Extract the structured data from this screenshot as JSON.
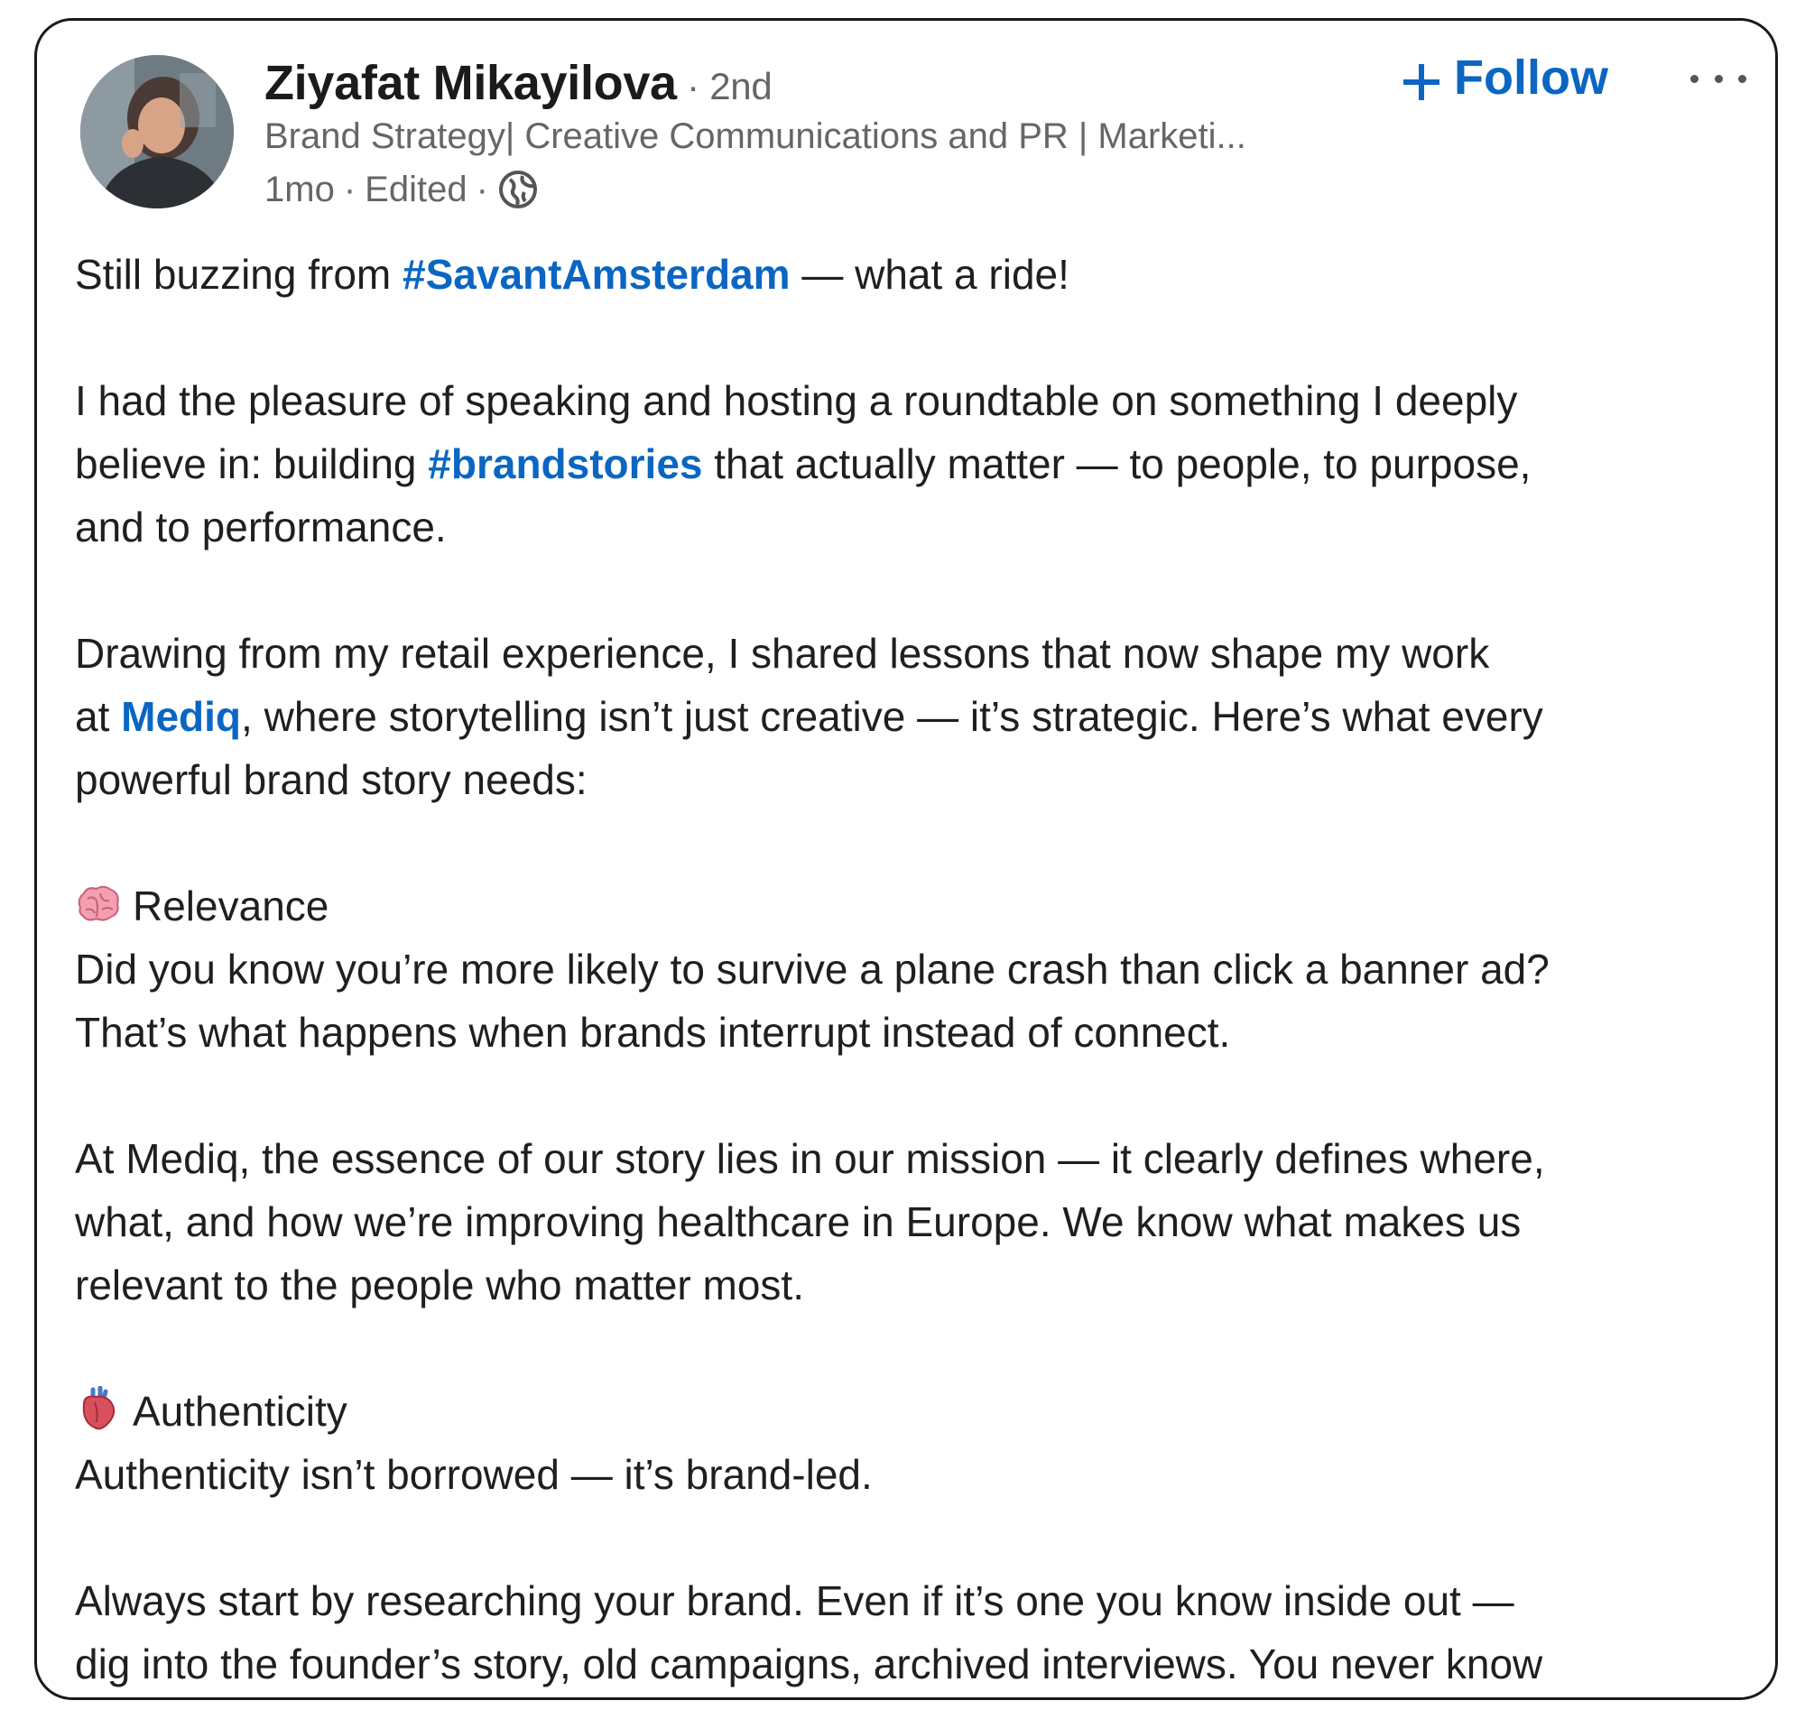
{
  "author": {
    "name": "Ziyafat Mikayilova",
    "degree": " · 2nd",
    "headline": "Brand Strategy| Creative Communications and PR | Marketi...",
    "time": "1mo",
    "sep1": "·",
    "edited": "Edited",
    "sep2": "·"
  },
  "actions": {
    "follow_label": "Follow"
  },
  "post": {
    "l1_pre": "Still buzzing from ",
    "l1_tag": "#SavantAmsterdam",
    "l1_post": " — what a ride!",
    "p2_l1": "I had the pleasure of speaking and hosting a roundtable on something I deeply",
    "p2_l2_pre": "believe in: building ",
    "p2_l2_tag": "#brandstories",
    "p2_l2_post": " that actually matter — to people, to purpose,",
    "p2_l3": "and to performance.",
    "p3_l1": "Drawing from my retail experience, I shared lessons that now shape my work",
    "p3_l2_pre": "at ",
    "p3_l2_link": "Mediq",
    "p3_l2_post": ", where storytelling isn’t just creative — it’s strategic. Here’s what every",
    "p3_l3": "powerful brand story needs:",
    "relevance_title": "Relevance",
    "relevance_l1": "Did you know you’re more likely to survive a plane crash than click a banner ad?",
    "relevance_l2": "That’s what happens when brands interrupt instead of connect.",
    "p5_l1": "At Mediq, the essence of our story lies in our mission — it clearly defines where,",
    "p5_l2": "what, and how we’re improving healthcare in Europe. We know what makes us",
    "p5_l3": "relevant to the people who matter most.",
    "authenticity_title": "Authenticity",
    "authenticity_l1": "Authenticity isn’t borrowed — it’s brand-led.",
    "p7_l1": "Always start by researching your brand. Even if it’s one you know inside out —",
    "p7_l2": "dig into the founder’s story, old campaigns, archived interviews. You never know"
  },
  "icons": {
    "relevance": "brain-icon",
    "authenticity": "anatomical-heart-icon",
    "visibility": "globe-icon"
  },
  "colors": {
    "link": "#0a66c2",
    "secondary_text": "#666666",
    "primary_text": "#1f1f1f"
  }
}
